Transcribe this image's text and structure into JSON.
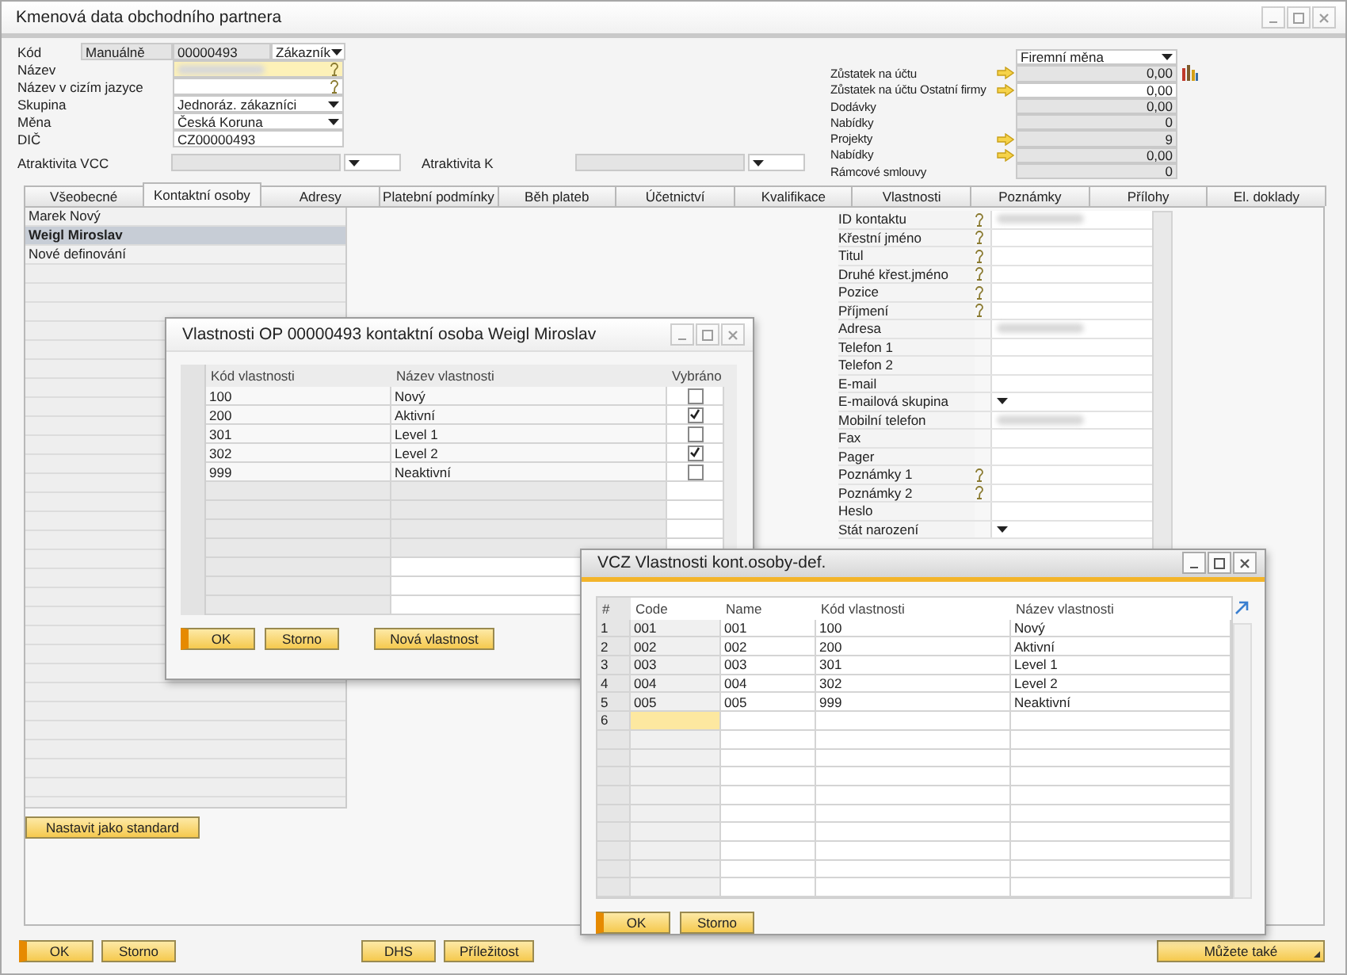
{
  "window": {
    "title": "Kmenová data obchodního partnera"
  },
  "header": {
    "code": {
      "label": "Kód",
      "numbering": "Manuálně",
      "value": "00000493",
      "type": "Zákazník"
    },
    "fields": [
      {
        "label": "Název",
        "kind": "lookup",
        "blurred": true,
        "required": true
      },
      {
        "label": "Název v cizím jazyce",
        "kind": "lookup",
        "blurred": false,
        "required": false
      },
      {
        "label": "Skupina",
        "kind": "dropdown",
        "value": "Jednoráz. zákazníci",
        "blurred": false,
        "required": false
      },
      {
        "label": "Měna",
        "kind": "dropdown",
        "value": "Česká Koruna",
        "blurred": false,
        "required": false
      },
      {
        "label": "DIČ",
        "kind": "text",
        "value": "CZ00000493",
        "blurred": false,
        "required": false
      }
    ],
    "attractiveness": [
      {
        "label": "Atraktivita VCC"
      },
      {
        "label": "Atraktivita K"
      }
    ]
  },
  "balances": {
    "currency": "Firemní měna",
    "rows": [
      {
        "label": "Zůstatek na účtu",
        "value": "0,00",
        "link": true,
        "editable": false,
        "chart": true
      },
      {
        "label": "Zůstatek na účtu Ostatní firmy",
        "value": "0,00",
        "link": true,
        "editable": true,
        "chart": false
      },
      {
        "label": "Dodávky",
        "value": "0,00",
        "link": false,
        "editable": false,
        "chart": false
      },
      {
        "label": "Nabídky",
        "value": "0",
        "link": false,
        "editable": false,
        "chart": false
      },
      {
        "label": "Projekty",
        "value": "9",
        "link": true,
        "editable": false,
        "chart": false
      },
      {
        "label": "Nabídky",
        "value": "0,00",
        "link": true,
        "editable": false,
        "chart": false
      },
      {
        "label": "Rámcové smlouvy",
        "value": "0",
        "link": false,
        "editable": false,
        "chart": false
      }
    ]
  },
  "tabs": [
    {
      "label": "Všeobecné",
      "selected": false
    },
    {
      "label": "Kontaktní osoby",
      "selected": true
    },
    {
      "label": "Adresy",
      "selected": false
    },
    {
      "label": "Platební podmínky",
      "selected": false
    },
    {
      "label": "Běh plateb",
      "selected": false
    },
    {
      "label": "Účetnictví",
      "selected": false
    },
    {
      "label": "Kvalifikace",
      "selected": false
    },
    {
      "label": "Vlastnosti",
      "selected": false
    },
    {
      "label": "Poznámky",
      "selected": false
    },
    {
      "label": "Přílohy",
      "selected": false
    },
    {
      "label": "El. doklady",
      "selected": false
    }
  ],
  "contacts": {
    "items": [
      {
        "name": "Marek Nový",
        "selected": false
      },
      {
        "name": "Weigl Miroslav",
        "selected": true
      },
      {
        "name": "Nové definování",
        "selected": false
      }
    ],
    "set_default_button": "Nastavit jako standard"
  },
  "contact_fields": [
    {
      "label": "ID kontaktu",
      "lookup": true,
      "kind": "text",
      "blurred": true
    },
    {
      "label": "Křestní jméno",
      "lookup": true,
      "kind": "text",
      "blurred": false
    },
    {
      "label": "Titul",
      "lookup": true,
      "kind": "text",
      "blurred": false
    },
    {
      "label": "Druhé křest.jméno",
      "lookup": true,
      "kind": "text",
      "blurred": false
    },
    {
      "label": "Pozice",
      "lookup": true,
      "kind": "text",
      "blurred": false
    },
    {
      "label": "Příjmení",
      "lookup": true,
      "kind": "text",
      "blurred": false
    },
    {
      "label": "Adresa",
      "lookup": false,
      "kind": "text",
      "blurred": true
    },
    {
      "label": "Telefon 1",
      "lookup": false,
      "kind": "text",
      "blurred": false
    },
    {
      "label": "Telefon 2",
      "lookup": false,
      "kind": "text",
      "blurred": false
    },
    {
      "label": "E-mail",
      "lookup": false,
      "kind": "text",
      "blurred": false
    },
    {
      "label": "E-mailová skupina",
      "lookup": false,
      "kind": "dropdown",
      "blurred": false
    },
    {
      "label": "Mobilní telefon",
      "lookup": false,
      "kind": "text",
      "blurred": true
    },
    {
      "label": "Fax",
      "lookup": false,
      "kind": "text",
      "blurred": false
    },
    {
      "label": "Pager",
      "lookup": false,
      "kind": "text",
      "blurred": false
    },
    {
      "label": "Poznámky 1",
      "lookup": true,
      "kind": "text",
      "blurred": false
    },
    {
      "label": "Poznámky 2",
      "lookup": true,
      "kind": "text",
      "blurred": false
    },
    {
      "label": "Heslo",
      "lookup": false,
      "kind": "text",
      "blurred": false
    },
    {
      "label": "Stát narození",
      "lookup": false,
      "kind": "dropdown",
      "blurred": false
    }
  ],
  "buttons": {
    "left": [
      {
        "label": "OK",
        "default": true,
        "menu": false
      },
      {
        "label": "Storno",
        "default": false,
        "menu": false
      }
    ],
    "center": [
      {
        "label": "DHS",
        "default": false,
        "menu": false
      },
      {
        "label": "Příležitost",
        "default": false,
        "menu": false
      }
    ],
    "right": [
      {
        "label": "Můžete také",
        "default": false,
        "menu": true
      }
    ]
  },
  "properties_dialog": {
    "title": "Vlastnosti OP 00000493 kontaktní osoba Weigl Miroslav",
    "columns": [
      "Kód vlastnosti",
      "Název vlastnosti",
      "Vybráno"
    ],
    "rows": [
      {
        "code": "100",
        "name": "Nový",
        "checked": false
      },
      {
        "code": "200",
        "name": "Aktivní",
        "checked": true
      },
      {
        "code": "301",
        "name": "Level 1",
        "checked": false
      },
      {
        "code": "302",
        "name": "Level 2",
        "checked": true
      },
      {
        "code": "999",
        "name": "Neaktivní",
        "checked": false
      }
    ],
    "buttons": [
      {
        "label": "OK",
        "default": true
      },
      {
        "label": "Storno",
        "default": false
      },
      {
        "label": "Nová vlastnost",
        "default": false
      }
    ]
  },
  "definitions_dialog": {
    "title": "VCZ Vlastnosti kont.osoby-def.",
    "columns": [
      "#",
      "Code",
      "Name",
      "Kód vlastnosti",
      "Název vlastnosti"
    ],
    "rows": [
      {
        "number": "1",
        "code": "001",
        "name": "001",
        "property_code": "100",
        "property_name": "Nový",
        "editing": false
      },
      {
        "number": "2",
        "code": "002",
        "name": "002",
        "property_code": "200",
        "property_name": "Aktivní",
        "editing": false
      },
      {
        "number": "3",
        "code": "003",
        "name": "003",
        "property_code": "301",
        "property_name": "Level 1",
        "editing": false
      },
      {
        "number": "4",
        "code": "004",
        "name": "004",
        "property_code": "302",
        "property_name": "Level 2",
        "editing": false
      },
      {
        "number": "5",
        "code": "005",
        "name": "005",
        "property_code": "999",
        "property_name": "Neaktivní",
        "editing": false
      },
      {
        "number": "6",
        "editing": true
      }
    ],
    "buttons": [
      {
        "label": "OK",
        "default": true
      },
      {
        "label": "Storno",
        "default": false
      }
    ]
  }
}
